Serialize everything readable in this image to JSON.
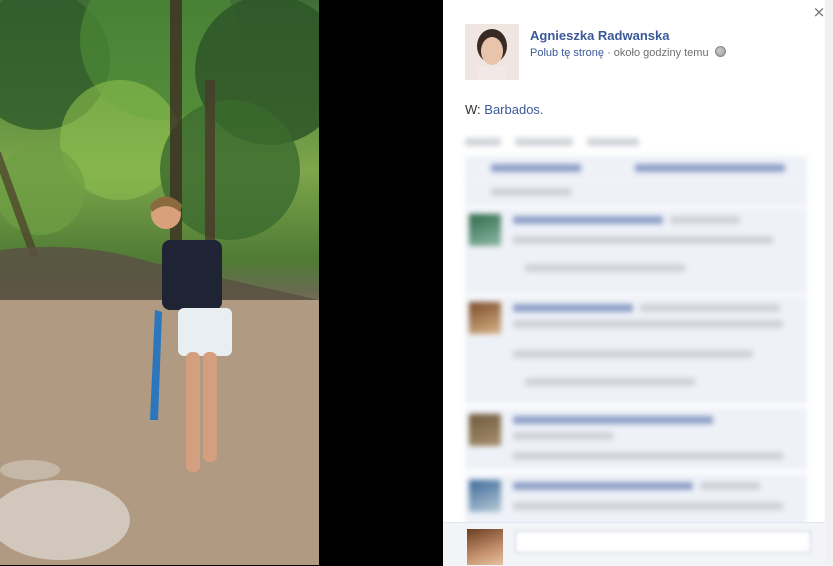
{
  "post": {
    "author_name": "Agnieszka Radwanska",
    "like_page_label": "Polub tę stronę",
    "separator": "·",
    "timestamp": "około godziny temu",
    "caption_prefix": "W:",
    "caption_place": "Barbados."
  },
  "close_label": "×",
  "icons": {
    "close": "close-icon",
    "privacy": "globe-icon"
  },
  "colors": {
    "link_blue": "#3b5998",
    "meta_gray": "#6f6f6f",
    "comment_bg": "#eef1f7"
  }
}
